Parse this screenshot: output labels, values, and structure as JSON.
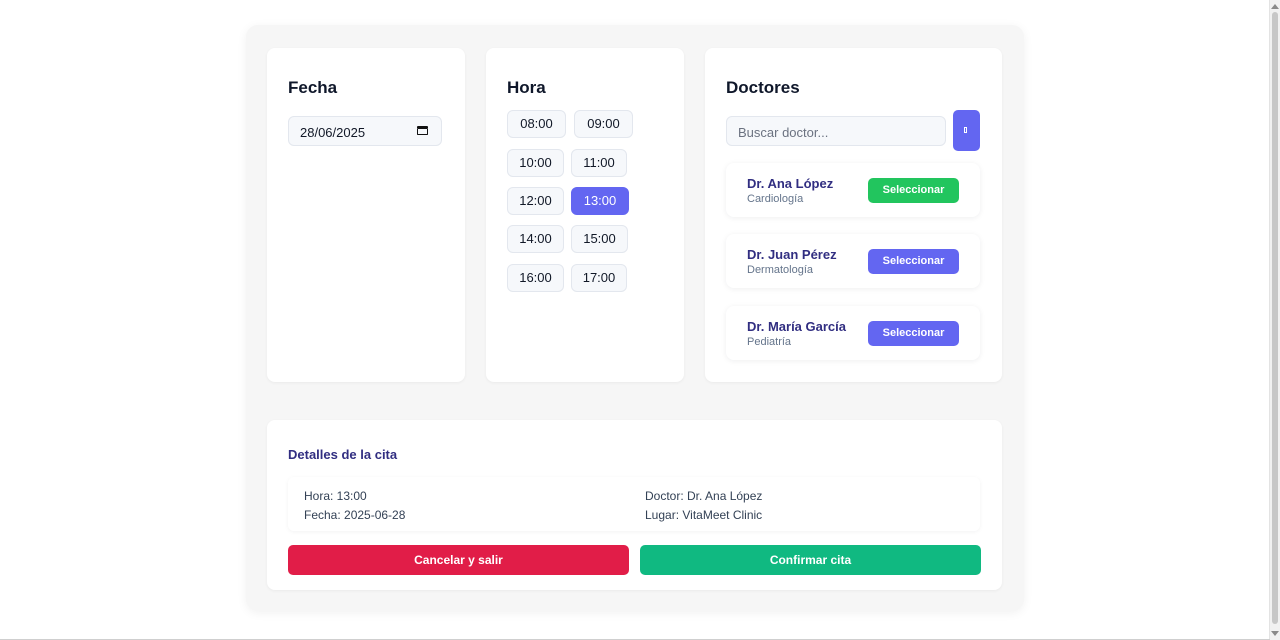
{
  "fecha": {
    "title": "Fecha",
    "date_value": "28/06/2025"
  },
  "hora": {
    "title": "Hora",
    "slots": [
      "08:00",
      "09:00",
      "10:00",
      "11:00",
      "12:00",
      "13:00",
      "14:00",
      "15:00",
      "16:00",
      "17:00"
    ],
    "selected": "13:00"
  },
  "doctores": {
    "title": "Doctores",
    "search_placeholder": "Buscar doctor...",
    "search_button_icon": "search-icon",
    "list": [
      {
        "name": "Dr. Ana López",
        "specialty": "Cardiología",
        "button": "Seleccionar",
        "button_color": "#22c55e"
      },
      {
        "name": "Dr. Juan Pérez",
        "specialty": "Dermatología",
        "button": "Seleccionar",
        "button_color": "#6366f1"
      },
      {
        "name": "Dr. María García",
        "specialty": "Pediatría",
        "button": "Seleccionar",
        "button_color": "#6366f1"
      }
    ]
  },
  "detalles": {
    "title": "Detalles de la cita",
    "hora": "Hora: 13:00",
    "fecha": "Fecha: 2025-06-28",
    "doctor": "Doctor: Dr. Ana López",
    "lugar": "Lugar: VitaMeet Clinic",
    "cancel_label": "Cancelar y salir",
    "confirm_label": "Confirmar cita"
  },
  "colors": {
    "accent": "#6366f1",
    "success": "#22c55e",
    "confirm": "#10b981",
    "danger": "#e11d48",
    "heading": "#312e81"
  }
}
